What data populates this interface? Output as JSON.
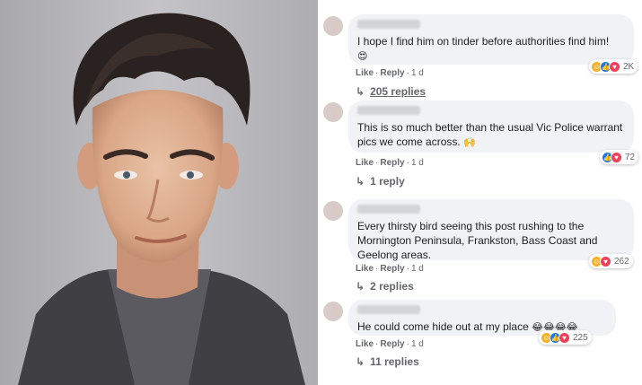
{
  "comments": [
    {
      "text": "I hope I find him on tinder before authorities find him!",
      "emoji": "😍",
      "like_label": "Like",
      "reply_label": "Reply",
      "time": "1 d",
      "reaction_count": "2K",
      "reactions": [
        "haha-icon",
        "like-icon",
        "love-icon"
      ],
      "replies_label": "205 replies"
    },
    {
      "text": "This is so much better than the usual Vic Police warrant pics we come across.",
      "emoji": "🙌",
      "like_label": "Like",
      "reply_label": "Reply",
      "time": "1 d",
      "reaction_count": "72",
      "reactions": [
        "like-icon",
        "love-icon"
      ],
      "replies_label": "1 reply"
    },
    {
      "text": "Every thirsty bird seeing this post rushing to the Mornington Peninsula, Frankston, Bass Coast and Geelong areas.",
      "emoji": "",
      "like_label": "Like",
      "reply_label": "Reply",
      "time": "1 d",
      "reaction_count": "262",
      "reactions": [
        "haha-icon",
        "love-icon"
      ],
      "replies_label": "2 replies"
    },
    {
      "text": "He could come hide out at my place",
      "emoji": "😂😂😂😂",
      "like_label": "Like",
      "reply_label": "Reply",
      "time": "1 d",
      "reaction_count": "225",
      "reactions": [
        "haha-icon",
        "like-icon",
        "love-icon"
      ],
      "replies_label": "11 replies"
    }
  ],
  "colors": {
    "bubble": "#f0f2f5",
    "meta_text": "#65676b",
    "like_blue": "#1877f2",
    "love_red": "#f33e58",
    "haha_yellow": "#f7b125"
  }
}
